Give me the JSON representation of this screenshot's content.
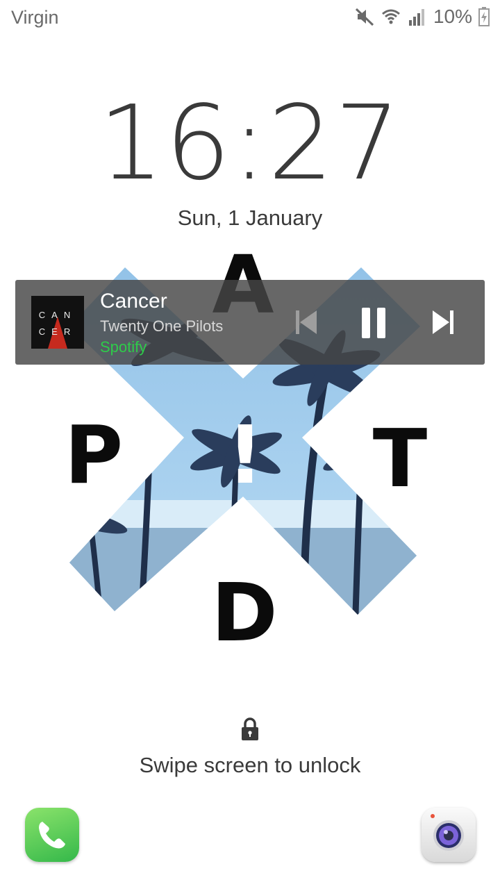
{
  "status_bar": {
    "carrier": "Virgin",
    "battery_percent": "10%",
    "icons": [
      "mute-icon",
      "wifi-icon",
      "signal-icon",
      "battery-charging-icon"
    ]
  },
  "lockscreen": {
    "time": "16:27",
    "date": "Sun, 1 January",
    "unlock_hint": "Swipe screen to unlock"
  },
  "wallpaper": {
    "letters": [
      "A",
      "P",
      "!",
      "T",
      "D"
    ]
  },
  "music": {
    "title": "Cancer",
    "artist": "Twenty One Pilots",
    "app": "Spotify",
    "album_art_lines": [
      "CAN",
      "CER"
    ],
    "controls": [
      "previous-icon",
      "pause-icon",
      "next-icon"
    ],
    "app_color": "#2ecc4a"
  },
  "shortcuts": {
    "left": "phone-icon",
    "right": "camera-icon"
  }
}
